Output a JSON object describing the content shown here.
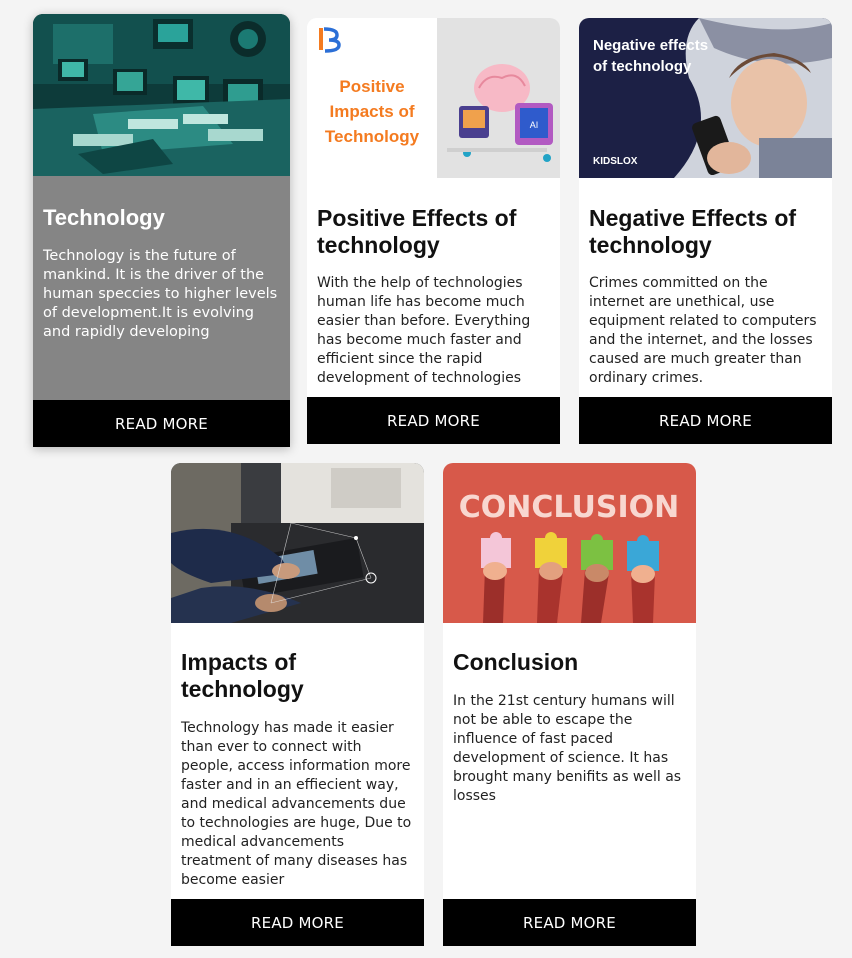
{
  "cards": [
    {
      "title": "Technology",
      "text": "Technology is the future of mankind. It is the driver of the human speccies to higher levels of development.It is evolving and rapidly developing",
      "button": "READ MORE"
    },
    {
      "title": "Positive Effects of technology",
      "text": "With the help of technologies human life has become much easier than before. Everything has become much faster and efficient since the rapid development of technologies",
      "button": "READ MORE",
      "image": {
        "logo": "B",
        "headline": [
          "Positive",
          "Impacts of",
          "Technology"
        ]
      }
    },
    {
      "title": "Negative Effects of technology",
      "text": "Crimes committed on the internet are unethical, use equipment related to computers and the internet, and the losses caused are much greater than ordinary crimes.",
      "button": "READ MORE",
      "image": {
        "headline": [
          "Negative effects",
          "of technology"
        ],
        "brand": "KIDSLOX"
      }
    },
    {
      "title": "Impacts of technology",
      "text": "Technology has made it easier than ever to connect with people, access information more faster and in an effiecient way, and medical advancements due to technologies are huge, Due to medical advancements treatment of many diseases has become easier",
      "button": "READ MORE"
    },
    {
      "title": "Conclusion",
      "text": "In the 21st century humans will not be able to escape the influence of fast paced development of science. It has brought many benifits as well as losses",
      "button": "READ MORE",
      "image": {
        "headline": "CONCLUSION"
      }
    }
  ],
  "colors": {
    "page_bg": "#f4f4f4",
    "button_bg": "#000000",
    "accent_orange": "#f47b20",
    "navy": "#1c2045",
    "conclusion_bg": "#d7594a"
  }
}
